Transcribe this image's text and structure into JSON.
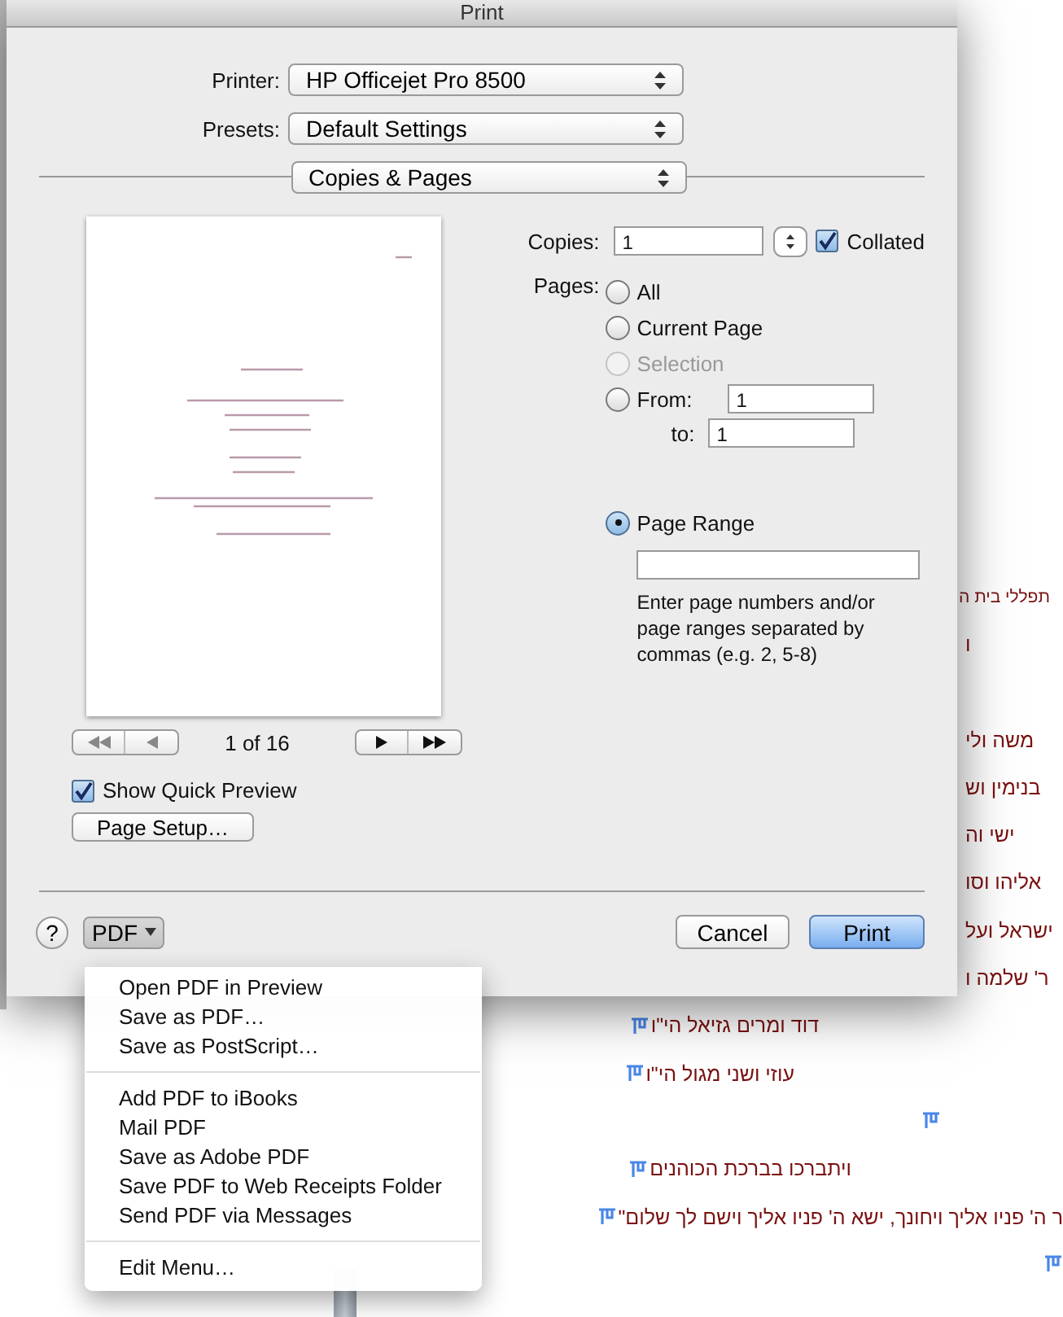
{
  "window": {
    "title": "Print"
  },
  "printer": {
    "label": "Printer:",
    "value": "HP Officejet Pro 8500"
  },
  "presets": {
    "label": "Presets:",
    "value": "Default Settings"
  },
  "section_menu": {
    "value": "Copies & Pages"
  },
  "preview": {
    "page_counter": "1 of 16",
    "show_quick_preview": {
      "label": "Show Quick Preview",
      "checked": true
    },
    "page_setup": "Page Setup…"
  },
  "copies": {
    "label": "Copies:",
    "value": "1",
    "collated": {
      "label": "Collated",
      "checked": true
    }
  },
  "pages": {
    "label": "Pages:",
    "options": [
      {
        "kind": "plain",
        "label": "All",
        "selected": false,
        "disabled": false
      },
      {
        "kind": "plain",
        "label": "Current Page",
        "selected": false,
        "disabled": false
      },
      {
        "kind": "plain",
        "label": "Selection",
        "selected": false,
        "disabled": true
      },
      {
        "kind": "from",
        "label": "From:",
        "selected": false,
        "disabled": false,
        "from_value": "1",
        "to_label": "to:",
        "to_value": "1"
      },
      {
        "kind": "range",
        "label": "Page Range",
        "selected": true,
        "disabled": false,
        "hint": "Enter page numbers and/or page ranges separated by commas (e.g. 2, 5-8)"
      }
    ]
  },
  "buttons": {
    "help": "?",
    "pdf": "PDF",
    "cancel": "Cancel",
    "print": "Print"
  },
  "pdf_menu": {
    "groups": [
      [
        "Open PDF in Preview",
        "Save as PDF…",
        "Save as PostScript…"
      ],
      [
        "Add PDF to iBooks",
        "Mail PDF",
        "Save as Adobe PDF",
        "Save PDF to Web Receipts Folder",
        "Send PDF via Messages"
      ],
      [
        "Edit Menu…"
      ]
    ]
  },
  "background_document": {
    "lines": [
      {
        "text": "תפללי בית ה"
      },
      {
        "text": "ו"
      },
      {
        "text": "משה ולי"
      },
      {
        "text": "בנימין וש"
      },
      {
        "text": "ישי וה"
      },
      {
        "text": "אליהו וסו"
      },
      {
        "text": "ישראל ועל"
      },
      {
        "text": "ר' שלמה ו"
      },
      {
        "text": "דוד ומרים גזיאל הי\"ו",
        "marker": true
      },
      {
        "text": "עוזי ושני מגול הי\"ו",
        "marker": true
      },
      {
        "marker": true
      },
      {
        "text": "ויתברכו בברכת הכוהנים",
        "marker": true
      },
      {
        "text": "ר ה' פניו אליך ויחונך, ישא ה' פניו אליך וישם לך שלום\"",
        "marker": true
      },
      {
        "marker": true
      }
    ]
  }
}
